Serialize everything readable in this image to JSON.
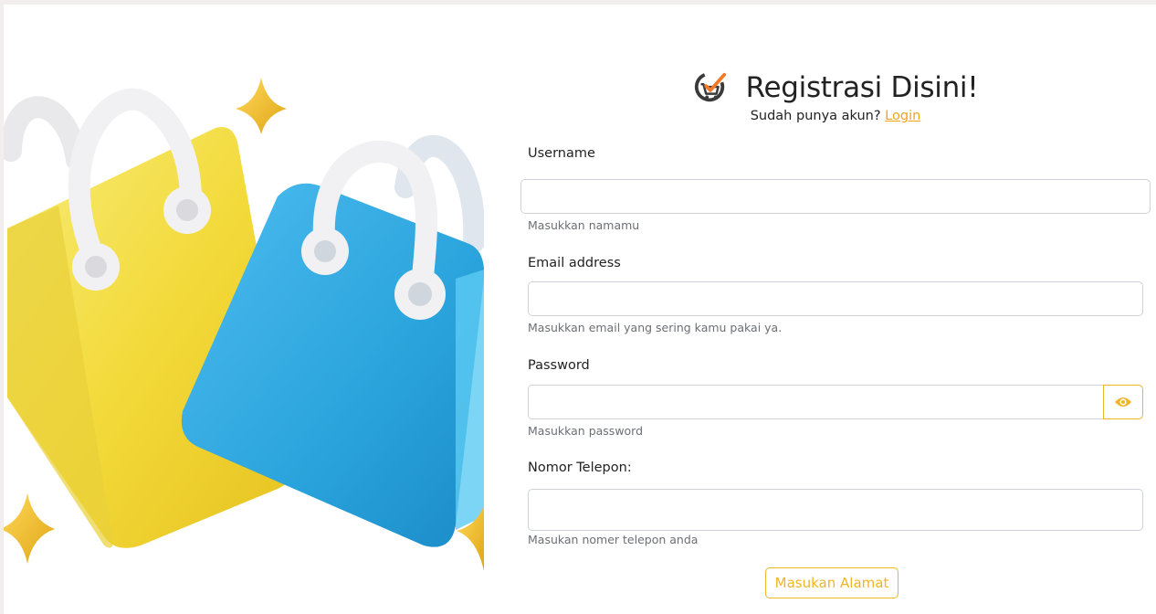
{
  "header": {
    "title": "Registrasi Disini!",
    "subtitle_prefix": "Sudah punya akun?",
    "login_link": "Login",
    "logo_icon": "cart-check-icon"
  },
  "form": {
    "username": {
      "label": "Username",
      "help": "Masukkan namamu",
      "value": ""
    },
    "email": {
      "label": "Email address",
      "help": "Masukkan email yang sering kamu pakai ya.",
      "value": ""
    },
    "password": {
      "label": "Password",
      "help": "Masukkan password",
      "value": "",
      "toggle_icon": "eye-icon"
    },
    "phone": {
      "label": "Nomor Telepon:",
      "help": "Masukan nomer telepon anda",
      "value": ""
    },
    "address_button": "Masukan Alamat"
  },
  "hero": {
    "image": "shopping-bags-illustration"
  },
  "colors": {
    "accent": "#f0b526",
    "link": "#f0a51d",
    "yellow_bag": "#f3d93a",
    "blue_bag": "#2ea8e0",
    "star": "#f1c233"
  }
}
